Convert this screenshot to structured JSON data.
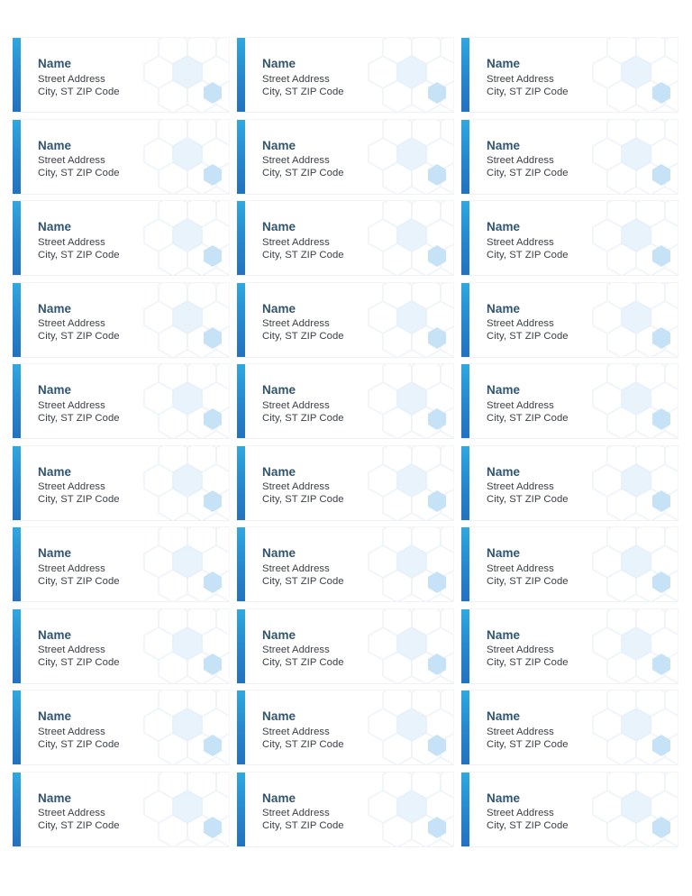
{
  "document": {
    "type": "address-label-sheet",
    "page_background": "#ffffff",
    "columns": 3,
    "rows": 10,
    "total_labels": 30
  },
  "theme": {
    "accent_bar_top": "#31a8e0",
    "accent_bar_bottom": "#2272bf",
    "name_color": "#31556f",
    "address_color": "#3b4148",
    "watermark_outline_color": "#eef4fa",
    "watermark_solid_hex_color": "#c5e2f6",
    "label_border_color": "#f1f5f8"
  },
  "label_template": {
    "name": "Name",
    "address_line_1": "Street Address",
    "address_line_2": "City, ST ZIP Code",
    "accent_bar_name": "accent-bar",
    "watermark_name": "hexagon-watermark"
  },
  "labels": [
    {
      "id": 1,
      "name": "Name",
      "address_line_1": "Street Address",
      "address_line_2": "City, ST ZIP Code"
    },
    {
      "id": 2,
      "name": "Name",
      "address_line_1": "Street Address",
      "address_line_2": "City, ST ZIP Code"
    },
    {
      "id": 3,
      "name": "Name",
      "address_line_1": "Street Address",
      "address_line_2": "City, ST ZIP Code"
    },
    {
      "id": 4,
      "name": "Name",
      "address_line_1": "Street Address",
      "address_line_2": "City, ST ZIP Code"
    },
    {
      "id": 5,
      "name": "Name",
      "address_line_1": "Street Address",
      "address_line_2": "City, ST ZIP Code"
    },
    {
      "id": 6,
      "name": "Name",
      "address_line_1": "Street Address",
      "address_line_2": "City, ST ZIP Code"
    },
    {
      "id": 7,
      "name": "Name",
      "address_line_1": "Street Address",
      "address_line_2": "City, ST ZIP Code"
    },
    {
      "id": 8,
      "name": "Name",
      "address_line_1": "Street Address",
      "address_line_2": "City, ST ZIP Code"
    },
    {
      "id": 9,
      "name": "Name",
      "address_line_1": "Street Address",
      "address_line_2": "City, ST ZIP Code"
    },
    {
      "id": 10,
      "name": "Name",
      "address_line_1": "Street Address",
      "address_line_2": "City, ST ZIP Code"
    },
    {
      "id": 11,
      "name": "Name",
      "address_line_1": "Street Address",
      "address_line_2": "City, ST ZIP Code"
    },
    {
      "id": 12,
      "name": "Name",
      "address_line_1": "Street Address",
      "address_line_2": "City, ST ZIP Code"
    },
    {
      "id": 13,
      "name": "Name",
      "address_line_1": "Street Address",
      "address_line_2": "City, ST ZIP Code"
    },
    {
      "id": 14,
      "name": "Name",
      "address_line_1": "Street Address",
      "address_line_2": "City, ST ZIP Code"
    },
    {
      "id": 15,
      "name": "Name",
      "address_line_1": "Street Address",
      "address_line_2": "City, ST ZIP Code"
    },
    {
      "id": 16,
      "name": "Name",
      "address_line_1": "Street Address",
      "address_line_2": "City, ST ZIP Code"
    },
    {
      "id": 17,
      "name": "Name",
      "address_line_1": "Street Address",
      "address_line_2": "City, ST ZIP Code"
    },
    {
      "id": 18,
      "name": "Name",
      "address_line_1": "Street Address",
      "address_line_2": "City, ST ZIP Code"
    },
    {
      "id": 19,
      "name": "Name",
      "address_line_1": "Street Address",
      "address_line_2": "City, ST ZIP Code"
    },
    {
      "id": 20,
      "name": "Name",
      "address_line_1": "Street Address",
      "address_line_2": "City, ST ZIP Code"
    },
    {
      "id": 21,
      "name": "Name",
      "address_line_1": "Street Address",
      "address_line_2": "City, ST ZIP Code"
    },
    {
      "id": 22,
      "name": "Name",
      "address_line_1": "Street Address",
      "address_line_2": "City, ST ZIP Code"
    },
    {
      "id": 23,
      "name": "Name",
      "address_line_1": "Street Address",
      "address_line_2": "City, ST ZIP Code"
    },
    {
      "id": 24,
      "name": "Name",
      "address_line_1": "Street Address",
      "address_line_2": "City, ST ZIP Code"
    },
    {
      "id": 25,
      "name": "Name",
      "address_line_1": "Street Address",
      "address_line_2": "City, ST ZIP Code"
    },
    {
      "id": 26,
      "name": "Name",
      "address_line_1": "Street Address",
      "address_line_2": "City, ST ZIP Code"
    },
    {
      "id": 27,
      "name": "Name",
      "address_line_1": "Street Address",
      "address_line_2": "City, ST ZIP Code"
    },
    {
      "id": 28,
      "name": "Name",
      "address_line_1": "Street Address",
      "address_line_2": "City, ST ZIP Code"
    },
    {
      "id": 29,
      "name": "Name",
      "address_line_1": "Street Address",
      "address_line_2": "City, ST ZIP Code"
    },
    {
      "id": 30,
      "name": "Name",
      "address_line_1": "Street Address",
      "address_line_2": "City, ST ZIP Code"
    }
  ]
}
